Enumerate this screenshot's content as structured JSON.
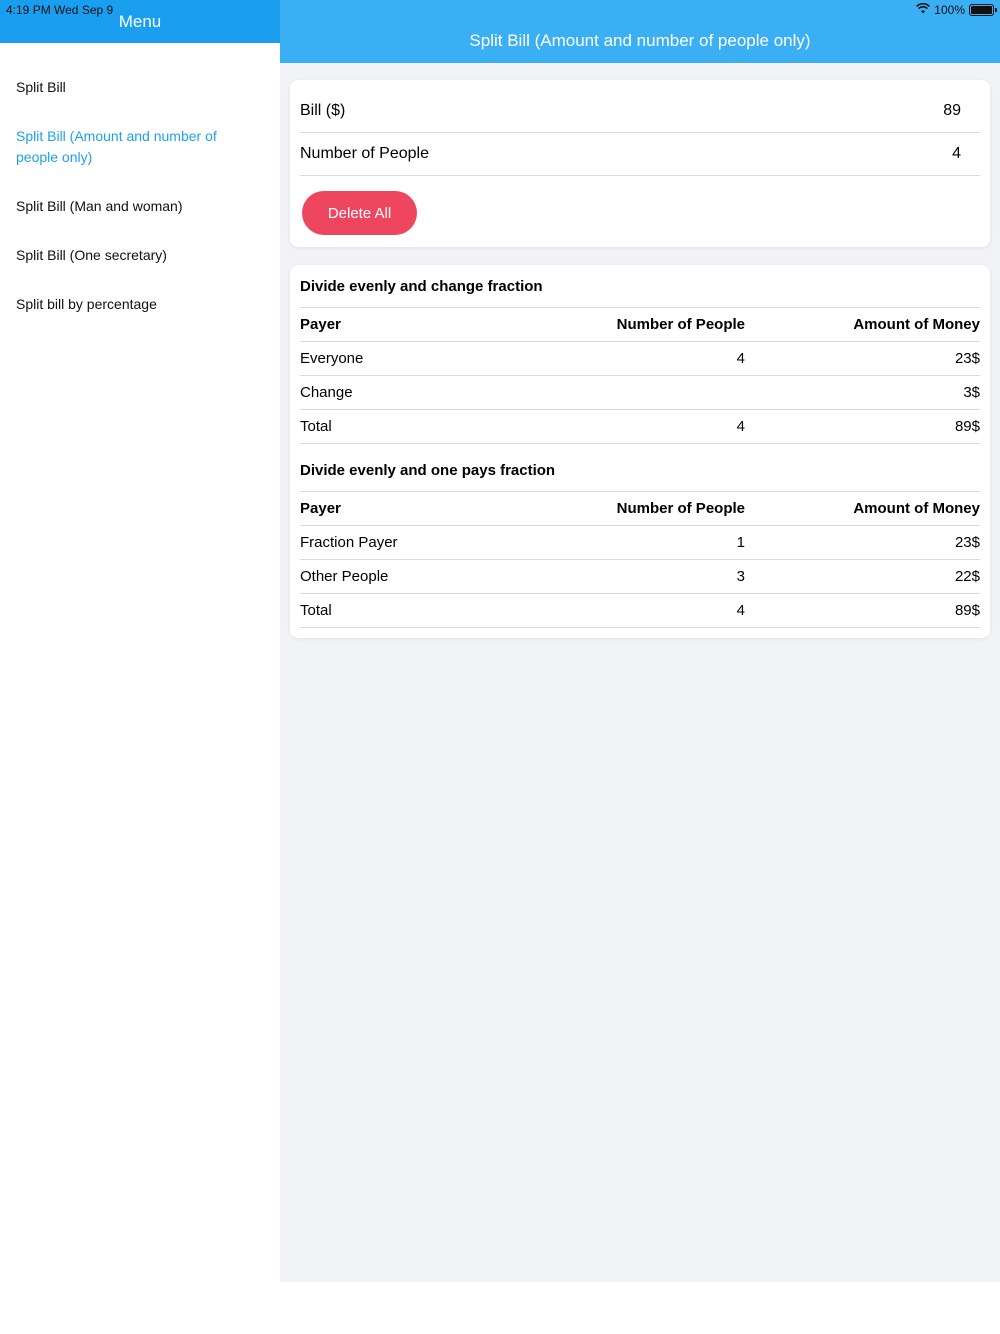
{
  "status_bar": {
    "time_date": "4:19 PM   Wed Sep 9",
    "battery_text": "100%",
    "wifi_icon": "wifi-icon",
    "battery_level": 1.0
  },
  "sidebar": {
    "title": "Menu",
    "items": [
      {
        "label": "Split Bill",
        "active": false
      },
      {
        "label": "Split Bill (Amount and number of people only)",
        "active": true
      },
      {
        "label": "Split Bill (Man and woman)",
        "active": false
      },
      {
        "label": "Split Bill (One secretary)",
        "active": false
      },
      {
        "label": "Split bill by percentage",
        "active": false
      }
    ]
  },
  "main": {
    "title": "Split Bill (Amount and number of people only)",
    "inputs": {
      "bill_label": "Bill ($)",
      "bill_value": "89",
      "people_label": "Number of People",
      "people_value": "4"
    },
    "delete_label": "Delete All",
    "sections": [
      {
        "title": "Divide evenly and change fraction",
        "headers": [
          "Payer",
          "Number of People",
          "Amount of Money"
        ],
        "rows": [
          [
            "Everyone",
            "4",
            "23$"
          ],
          [
            "Change",
            "",
            "3$"
          ],
          [
            "Total",
            "4",
            "89$"
          ]
        ]
      },
      {
        "title": "Divide evenly and one pays fraction",
        "headers": [
          "Payer",
          "Number of People",
          "Amount of Money"
        ],
        "rows": [
          [
            "Fraction Payer",
            "1",
            "23$"
          ],
          [
            "Other People",
            "3",
            "22$"
          ],
          [
            "Total",
            "4",
            "89$"
          ]
        ]
      }
    ]
  },
  "colors": {
    "sidebar_header": "#1a9ef0",
    "main_header": "#3baff4",
    "active_item": "#1ea0f0",
    "delete_button": "#ef4660",
    "background": "#f2f3f7"
  }
}
